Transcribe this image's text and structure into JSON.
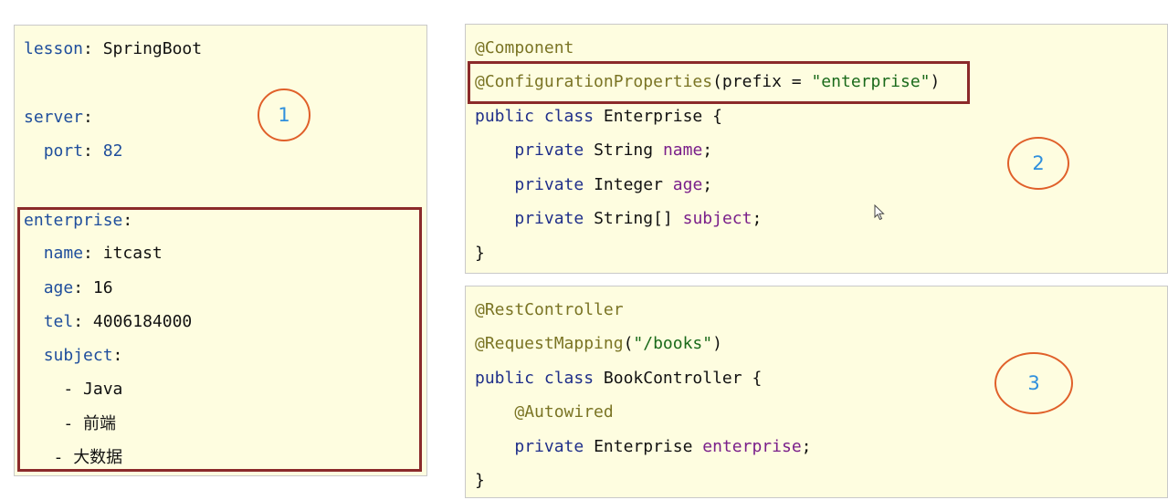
{
  "yaml": {
    "lesson_key": "lesson",
    "lesson_value": "SpringBoot",
    "server_key": "server",
    "port_key": "port",
    "port_value": "82",
    "enterprise_key": "enterprise",
    "name_key": "name",
    "name_value": "itcast",
    "age_key": "age",
    "age_value": "16",
    "tel_key": "tel",
    "tel_value": "4006184000",
    "subject_key": "subject",
    "subjects": [
      "Java",
      "前端",
      "大数据"
    ]
  },
  "entity_code": {
    "annotation1": "@Component",
    "annotation2": "@ConfigurationProperties",
    "annotation2_arg_prefix": "(prefix = ",
    "annotation2_arg_value": "\"enterprise\"",
    "annotation2_close": ")",
    "class_kw": "public class",
    "class_name": "Enterprise {",
    "private_kw": "private",
    "type_string": "String",
    "field_name": "name",
    "type_integer": "Integer",
    "field_age": "age",
    "type_string_array": "String[]",
    "field_subject": "subject",
    "semicolon": ";",
    "close_brace": "}"
  },
  "controller_code": {
    "annotation1": "@RestController",
    "annotation2": "@RequestMapping",
    "annotation2_open": "(",
    "annotation2_value": "\"/books\"",
    "annotation2_close": ")",
    "class_kw": "public class",
    "class_name": "BookController {",
    "autowired": "@Autowired",
    "private_kw": "private",
    "field_type": "Enterprise",
    "field_name": "enterprise",
    "semicolon": ";",
    "close_brace": "}"
  },
  "badges": {
    "b1": "1",
    "b2": "2",
    "b3": "3"
  },
  "colors": {
    "panel_bg": "#fefde0",
    "highlight_border": "#8b2a2a",
    "badge_ring": "#e0602a",
    "badge_text": "#2f8fdd"
  }
}
